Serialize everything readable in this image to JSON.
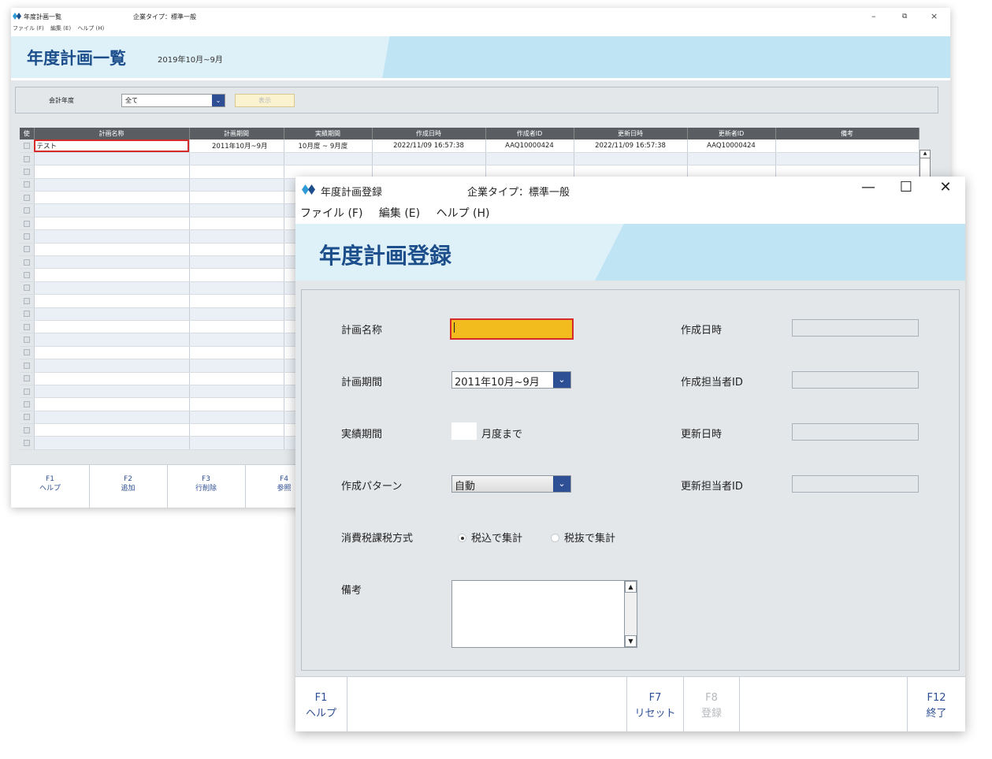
{
  "back_window": {
    "title": "年度計画一覧",
    "company_type": "企業タイプ：標準一般",
    "window_controls": {
      "minimize": "–",
      "restore": "⧉",
      "close": "×"
    },
    "menu": [
      "ファイル (F)",
      "編集 (E)",
      "ヘルプ (H)"
    ],
    "heading": "年度計画一覧",
    "subheading": "2019年10月~9月",
    "filter": {
      "label": "会計年度",
      "select_value": "全て",
      "show_button": "表示"
    },
    "table": {
      "headers": [
        "使",
        "計画名称",
        "計画期間",
        "実績期間",
        "作成日時",
        "作成者ID",
        "更新日時",
        "更新者ID",
        "備考"
      ],
      "rows": [
        [
          "",
          "テスト",
          "2011年10月~9月",
          "10月度 ~ 9月度",
          "2022/11/09 16:57:38",
          "AAQ10000424",
          "2022/11/09 16:57:38",
          "AAQ10000424",
          ""
        ]
      ],
      "empty_rows": 23
    },
    "fkeys": [
      {
        "key": "F1",
        "label": "ヘルプ"
      },
      {
        "key": "F2",
        "label": "追加"
      },
      {
        "key": "F3",
        "label": "行削除"
      },
      {
        "key": "F4",
        "label": "参照"
      }
    ]
  },
  "front_window": {
    "title": "年度計画登録",
    "company_type": "企業タイプ：標準一般",
    "window_controls": {
      "minimize": "—",
      "maximize": "☐",
      "close": "✕"
    },
    "menu": [
      "ファイル (F)",
      "編集 (E)",
      "ヘルプ (H)"
    ],
    "heading": "年度計画登録",
    "form": {
      "plan_name_label": "計画名称",
      "plan_name_value": "",
      "plan_period_label": "計画期間",
      "plan_period_value": "2011年10月~9月",
      "actual_period_label": "実績期間",
      "actual_period_value": "",
      "actual_period_suffix": "月度まで",
      "pattern_label": "作成パターン",
      "pattern_value": "自動",
      "tax_label": "消費税課税方式",
      "tax_options": [
        {
          "label": "税込で集計",
          "selected": true
        },
        {
          "label": "税抜で集計",
          "selected": false
        }
      ],
      "note_label": "備考",
      "note_value": "",
      "created_at_label": "作成日時",
      "creator_label": "作成担当者ID",
      "updated_at_label": "更新日時",
      "updater_label": "更新担当者ID"
    },
    "fkeys": [
      {
        "key": "F1",
        "label": "ヘルプ",
        "enabled": true
      },
      {
        "key": "F7",
        "label": "リセット",
        "enabled": true
      },
      {
        "key": "F8",
        "label": "登録",
        "enabled": false
      },
      {
        "key": "F12",
        "label": "終了",
        "enabled": true
      }
    ]
  },
  "colors": {
    "brand_blue": "#1d4e8c",
    "dropdown_blue": "#2e4f94",
    "banner_light": "#dff1f8",
    "banner_dark": "#bfe4f3",
    "highlight_red": "#d62b2b",
    "input_yellow": "#f2bb1e"
  }
}
